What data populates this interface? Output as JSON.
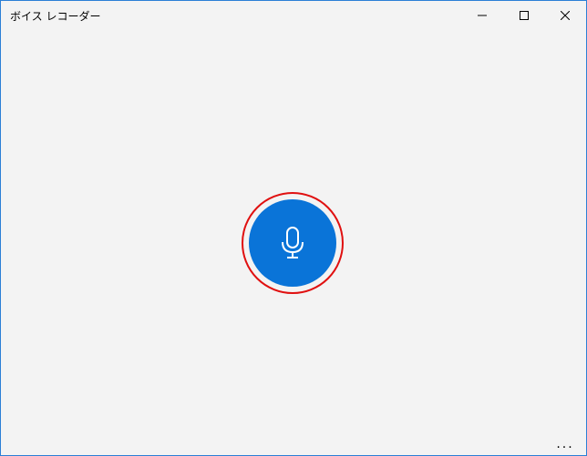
{
  "window": {
    "title": "ボイス レコーダー"
  },
  "caption_buttons": {
    "minimize": "minimize-icon",
    "maximize": "maximize-icon",
    "close": "close-icon"
  },
  "record": {
    "icon": "microphone-icon",
    "button_color": "#0a74d8",
    "highlight_color": "#e01010"
  },
  "more": {
    "label": "..."
  }
}
